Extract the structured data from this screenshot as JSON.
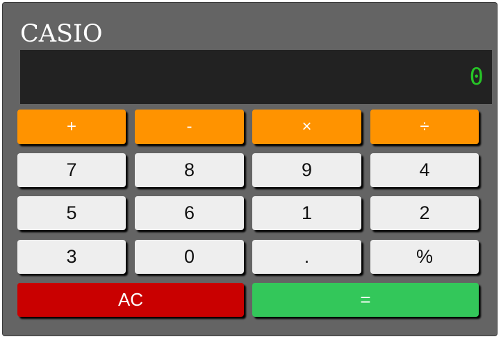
{
  "brand": "CASIO",
  "display": {
    "value": "0"
  },
  "operators": {
    "add": "+",
    "subtract": "-",
    "multiply": "×",
    "divide": "÷"
  },
  "keys": {
    "seven": "7",
    "eight": "8",
    "nine": "9",
    "four": "4",
    "five": "5",
    "six": "6",
    "one": "1",
    "two": "2",
    "three": "3",
    "zero": "0",
    "decimal": ".",
    "percent": "%"
  },
  "actions": {
    "clear": "AC",
    "equals": "="
  },
  "colors": {
    "body": "#646464",
    "display_bg": "#222222",
    "display_text": "#27c527",
    "operator": "#ff9300",
    "number": "#eeeeee",
    "clear": "#c90000",
    "equals": "#33c75a"
  }
}
